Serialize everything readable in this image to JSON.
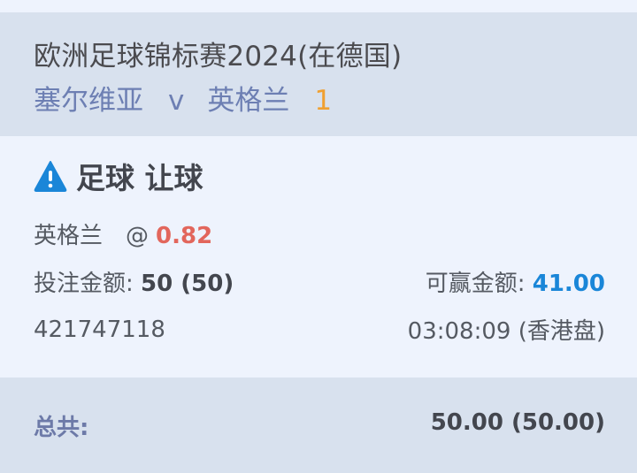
{
  "match": {
    "competition": "欧洲足球锦标赛2024(在德国)",
    "home_team": "塞尔维亚",
    "vs": "v",
    "away_team": "英格兰",
    "score": "1"
  },
  "bet": {
    "type_label": "足球 让球",
    "warning_icon": "warning-triangle-icon",
    "selection": "英格兰",
    "at_sign": "@",
    "odds": "0.82",
    "stake_label": "投注金额:",
    "stake_value": "50 (50)",
    "win_label": "可赢金额:",
    "win_value": "41.00",
    "ticket_id": "421747118",
    "time": "03:08:09 (香港盘)"
  },
  "footer": {
    "total_label": "总共:",
    "total_value": "50.00 (50.00)"
  },
  "colors": {
    "header_bg": "#d8e1ee",
    "card_bg": "#eef3fd",
    "team_text": "#6d7fb3",
    "score": "#f0a031",
    "odds": "#e2665c",
    "win_amount": "#1a86d8",
    "warning_icon": "#1a86d8"
  }
}
